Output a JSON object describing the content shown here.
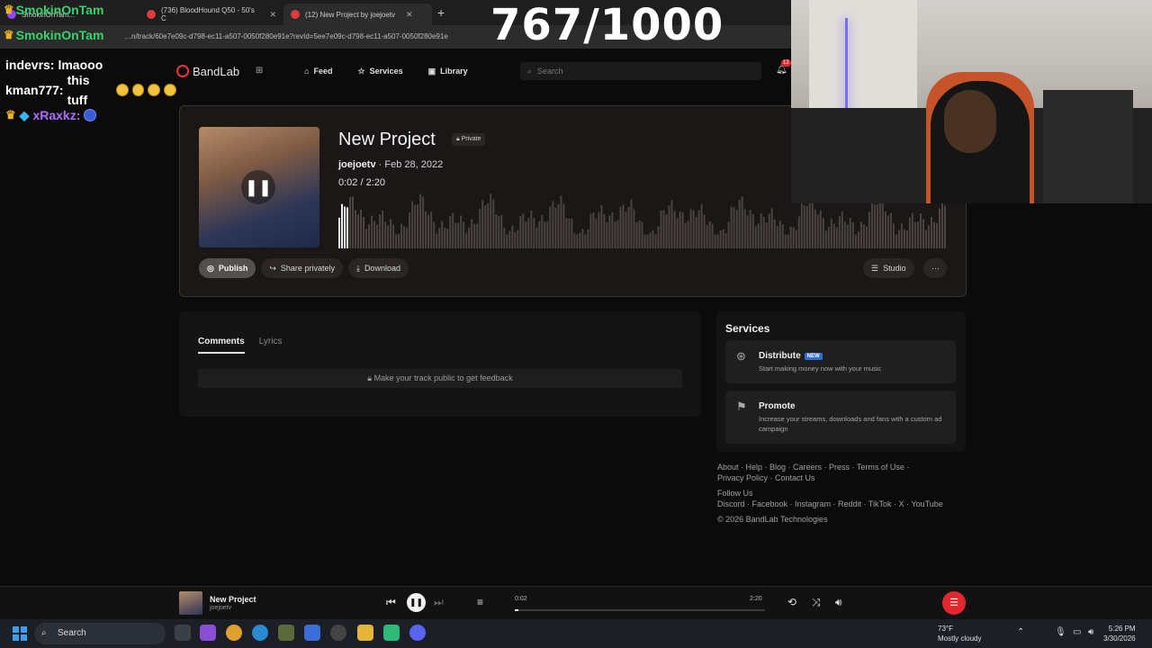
{
  "browser": {
    "tabs": [
      {
        "label": "SmokinOnTam..."
      },
      {
        "label": "(736) BloodHound Q50 - 50's C"
      },
      {
        "label": "(12) New Project by joejoetv"
      }
    ],
    "address": "…n/track/60e7e09c-d798-ec11-a507-0050f280e91e?revId=5ee7e09c-d798-ec11-a507-0050f280e91e"
  },
  "overlay": {
    "counter": "767/1000",
    "streamer_name_1": "SmokinOnTam",
    "streamer_name_2": "SmokinOnTam",
    "chat": [
      {
        "user": "indevrs:",
        "message": "lmaooo",
        "color": "#ffffff"
      },
      {
        "user": "kman777:",
        "message": "this tuff",
        "color": "#ffffff"
      },
      {
        "user": "xRaxkz:",
        "message": "",
        "color": "#b06cff"
      }
    ]
  },
  "header": {
    "brand": "BandLab",
    "nav": [
      "Feed",
      "Services",
      "Library"
    ],
    "search_placeholder": "Search",
    "notif_count": "12"
  },
  "track": {
    "title": "New Project",
    "visibility": "Private",
    "artist": "joejoetv",
    "date": "· Feb 28, 2022",
    "time": "0:02 /  2:20",
    "progress": 0.014,
    "actions": [
      "Publish",
      "Share privately",
      "Download"
    ],
    "studio": "Studio",
    "more": "···"
  },
  "comments": {
    "tabs": [
      "Comments",
      "Lyrics"
    ],
    "feedback": "Make your track public to get feedback"
  },
  "services": {
    "title": "Services",
    "items": [
      {
        "name": "Distribute",
        "badge": "NEW",
        "desc": "Start making money now with your music"
      },
      {
        "name": "Promote",
        "badge": "",
        "desc": "Increase your streams, downloads and fans with a custom ad campaign"
      }
    ]
  },
  "footer": {
    "row1": "About · Help · Blog · Careers · Press · Terms of Use ·",
    "row2": "Privacy Policy · Contact Us",
    "follow": "Follow Us",
    "socials": "Discord · Facebook · Instagram · Reddit · TikTok · X · YouTube",
    "copyright": "© 2026 BandLab Technologies"
  },
  "player": {
    "title": "New Project",
    "artist": "joejoetv",
    "current": "0:02",
    "total": "2:20",
    "progress": 0.014
  },
  "taskbar": {
    "search": "Search",
    "weather_temp": "73°F",
    "weather_desc": "Mostly cloudy",
    "time": "5:26 PM",
    "date": "3/30/2026"
  },
  "colors": {
    "accent": "#e3272e",
    "chat_green": "#34d36b"
  }
}
